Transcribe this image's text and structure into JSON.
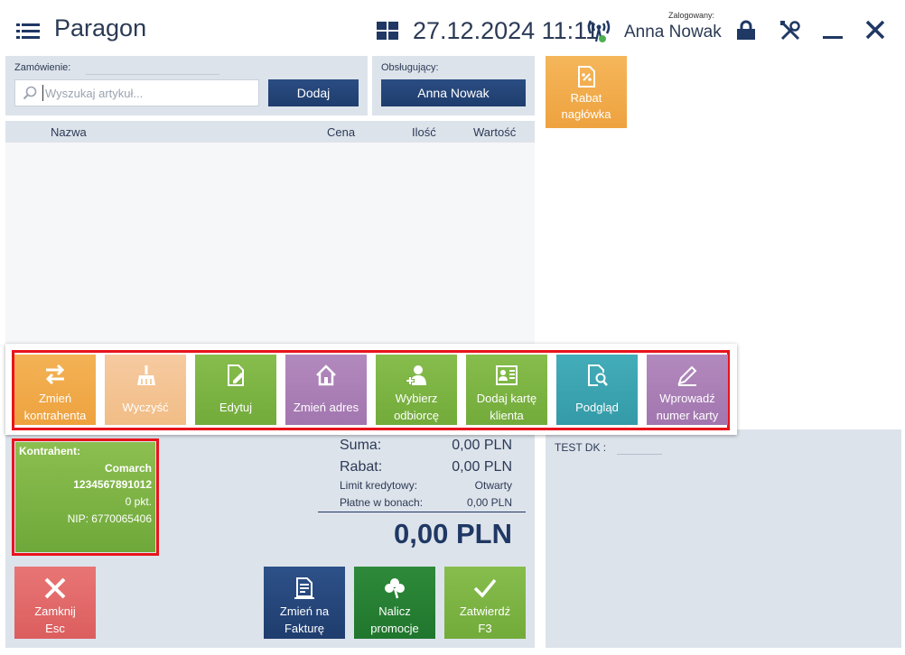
{
  "header": {
    "title": "Paragon",
    "datetime": "27.12.2024 11:11",
    "logged_in_label": "Zalogowany:",
    "user_name": "Anna Nowak"
  },
  "order": {
    "label": "Zamówienie:",
    "search_placeholder": "Wyszukaj artykuł...",
    "add_button": "Dodaj"
  },
  "serving": {
    "label": "Obsługujący:",
    "value": "Anna Nowak"
  },
  "header_discount": {
    "line1": "Rabat",
    "line2": "nagłówka"
  },
  "table": {
    "columns": [
      "Nazwa",
      "Cena",
      "Ilość",
      "Wartość"
    ]
  },
  "toolbar": [
    {
      "line1": "Zmień",
      "line2": "kontrahenta",
      "color": "#f0a646",
      "icon": "swap-arrows-icon"
    },
    {
      "line1": "Wyczyść",
      "line2": "",
      "color": "#f3c48a",
      "icon": "broom-icon"
    },
    {
      "line1": "Edytuj",
      "line2": "",
      "color": "#7cb342",
      "icon": "edit-document-icon"
    },
    {
      "line1": "Zmień adres",
      "line2": "",
      "color": "#a97bb5",
      "icon": "home-icon"
    },
    {
      "line1": "Wybierz",
      "line2": "odbiorcę",
      "color": "#7cb342",
      "icon": "user-add-icon"
    },
    {
      "line1": "Dodaj kartę",
      "line2": "klienta",
      "color": "#7cb342",
      "icon": "id-card-icon"
    },
    {
      "line1": "Podgląd",
      "line2": "",
      "color": "#3aa2b0",
      "icon": "preview-icon"
    },
    {
      "line1": "Wprowadź",
      "line2": "numer karty",
      "color": "#a97bb5",
      "icon": "pencil-icon"
    }
  ],
  "contractor": {
    "title": "Kontrahent:",
    "name": "Comarch",
    "code": "1234567891012",
    "points": "0 pkt.",
    "nip": "NIP: 6770065406"
  },
  "summary": {
    "sum_label": "Suma:",
    "sum_value": "0,00 PLN",
    "discount_label": "Rabat:",
    "discount_value": "0,00 PLN",
    "credit_label": "Limit kredytowy:",
    "credit_value": "Otwarty",
    "voucher_label": "Płatne w bonach:",
    "voucher_value": "0,00 PLN",
    "total": "0,00 PLN"
  },
  "side": {
    "test_dk_label": "TEST DK :"
  },
  "actions": {
    "close": {
      "line1": "Zamknij",
      "line2": "Esc"
    },
    "invoice": {
      "line1": "Zmień na",
      "line2": "Fakturę"
    },
    "promo": {
      "line1": "Nalicz",
      "line2": "promocje"
    },
    "confirm": {
      "line1": "Zatwierdź",
      "line2": "F3"
    }
  },
  "colors": {
    "navy": "#1f3864",
    "orange": "#f0a646",
    "green": "#7cb342",
    "red_close": "#e06666",
    "highlight": "#e8141b"
  }
}
